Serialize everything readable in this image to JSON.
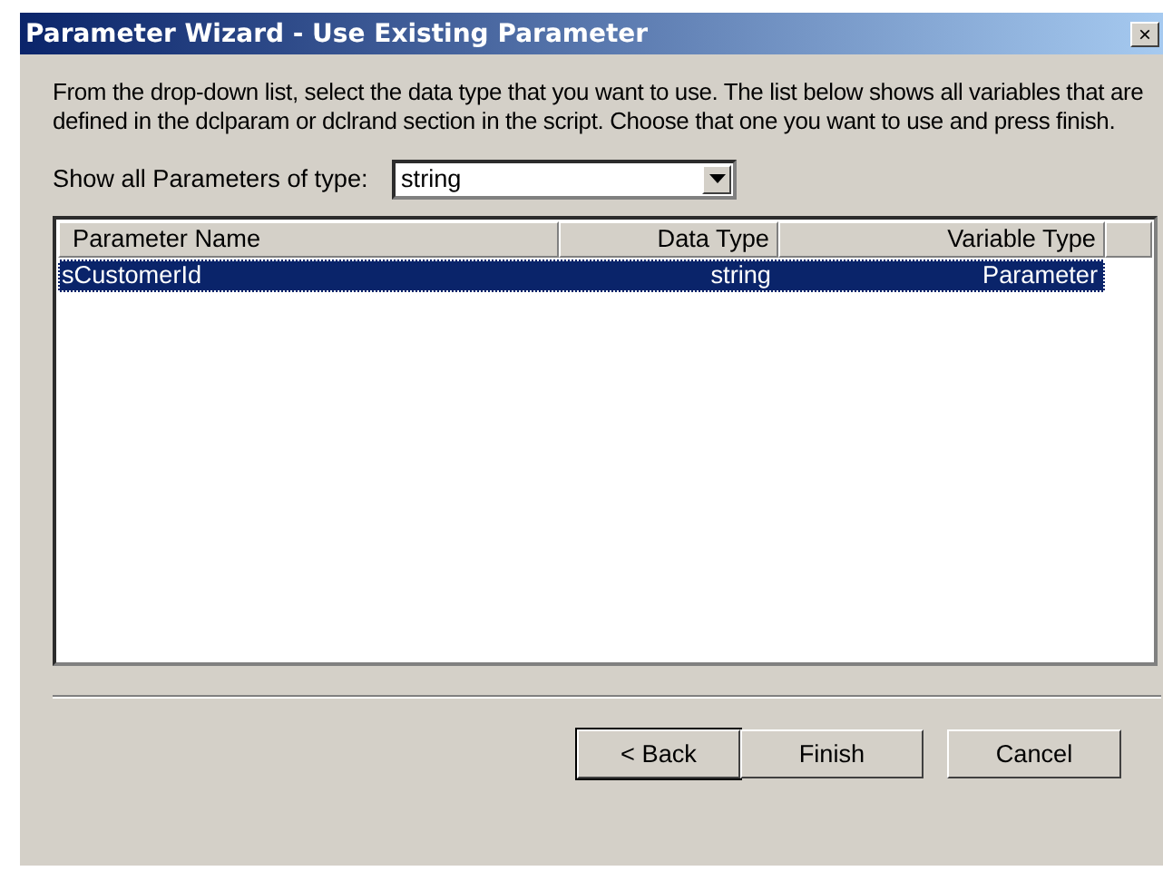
{
  "window": {
    "title": "Parameter Wizard - Use Existing Parameter",
    "close": "×"
  },
  "description": "From the drop-down list, select the data type that you want to use. The list below shows all variables that are defined in the dclparam or dclrand section in the script. Choose that one you want to use and press finish.",
  "type_filter": {
    "label": "Show all Parameters of type:",
    "value": "string"
  },
  "table": {
    "columns": [
      "Parameter Name",
      "Data Type",
      "Variable Type"
    ],
    "rows": [
      {
        "cells": [
          "sCustomerId",
          "string",
          "Parameter"
        ],
        "selected": true
      }
    ]
  },
  "buttons": [
    {
      "label": "< Back",
      "default": true
    },
    {
      "label": "Finish",
      "default": false
    },
    {
      "label": "Cancel",
      "default": false
    }
  ]
}
